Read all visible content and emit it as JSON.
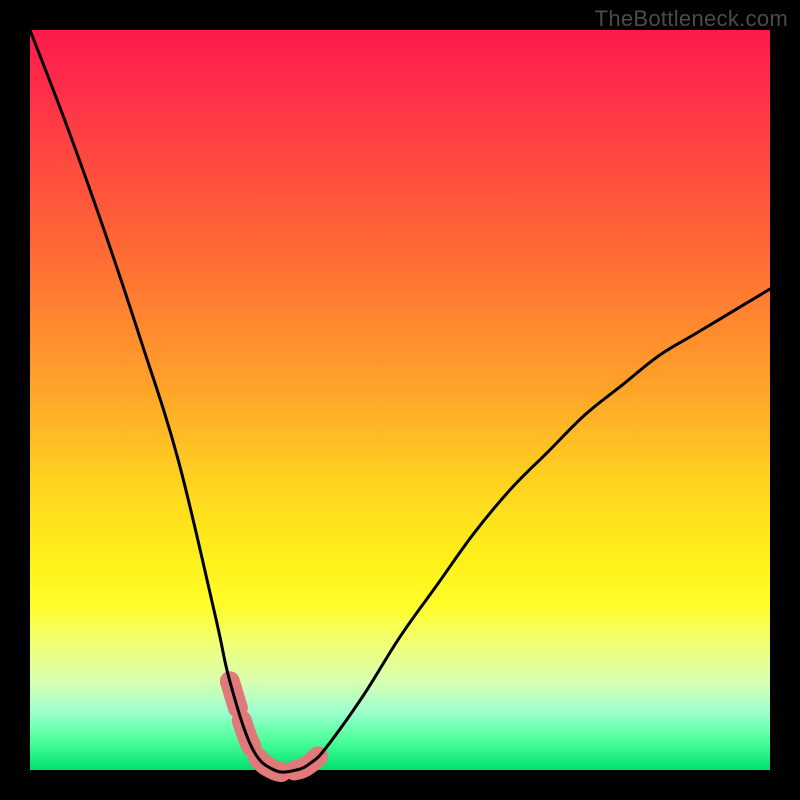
{
  "watermark": "TheBottleneck.com",
  "colors": {
    "frame": "#000000",
    "curve": "#000000",
    "marker": "#e07a7a",
    "gradient_top": "#ff1a4a",
    "gradient_bottom": "#00e070"
  },
  "chart_data": {
    "type": "line",
    "title": "",
    "xlabel": "",
    "ylabel": "",
    "xlim": [
      0,
      100
    ],
    "ylim": [
      0,
      100
    ],
    "x": [
      0,
      5,
      10,
      15,
      20,
      25,
      27,
      30,
      33,
      36,
      38,
      40,
      45,
      50,
      55,
      60,
      65,
      70,
      75,
      80,
      85,
      90,
      95,
      100
    ],
    "y": [
      100,
      87,
      73,
      58,
      42,
      21,
      12,
      3,
      0,
      0,
      1,
      3,
      10,
      18,
      25,
      32,
      38,
      43,
      48,
      52,
      56,
      59,
      62,
      65
    ],
    "valley_segment_x": [
      27,
      30,
      33,
      36,
      38,
      40
    ],
    "valley_segment_y": [
      12,
      3,
      0,
      0,
      1,
      3
    ],
    "annotations": []
  }
}
